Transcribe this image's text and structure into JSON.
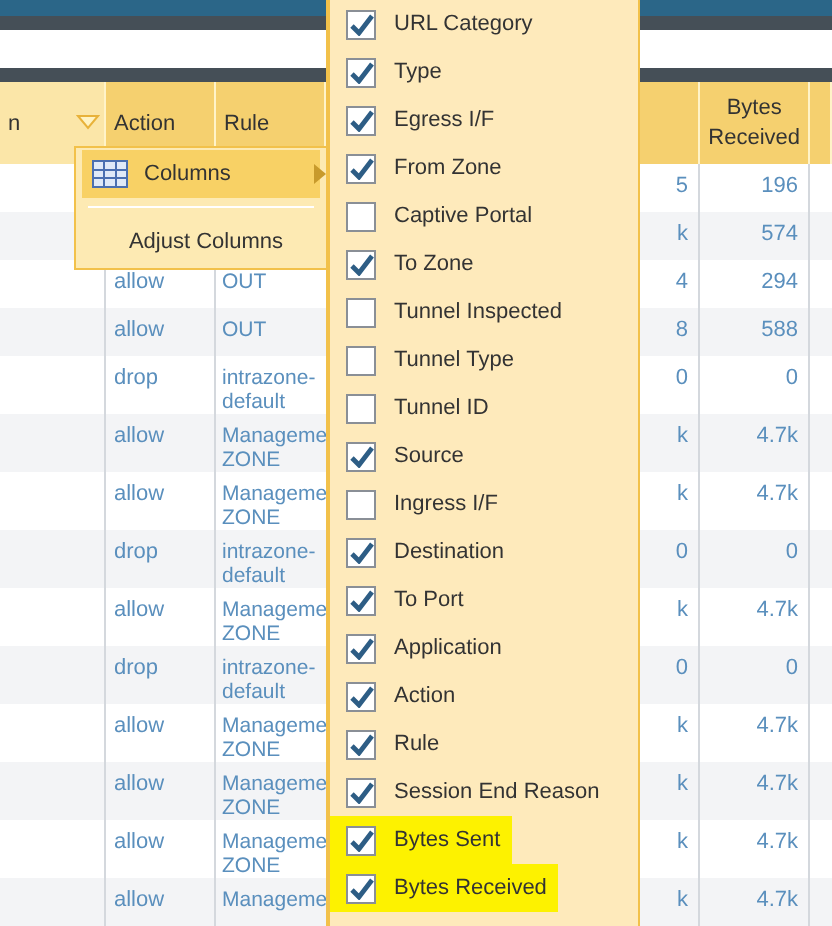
{
  "table": {
    "columns": [
      {
        "label": "n",
        "menu_open": true
      },
      {
        "label": "Action"
      },
      {
        "label": "Rule"
      },
      {
        "label": "Bytes Received"
      }
    ],
    "rows": [
      {
        "column_4": "5",
        "bytes_received": "196"
      },
      {
        "column_4": "k",
        "bytes_received": "574"
      },
      {
        "action": "allow",
        "rule": "OUT",
        "column_4": "4",
        "bytes_received": "294"
      },
      {
        "action": "allow",
        "rule": "OUT",
        "column_4": "8",
        "bytes_received": "588"
      },
      {
        "action": "drop",
        "rule": "intrazone-default",
        "column_4": "0",
        "bytes_received": "0"
      },
      {
        "action": "allow",
        "rule": "Manageme ZONE",
        "column_4": "k",
        "bytes_received": "4.7k"
      },
      {
        "action": "allow",
        "rule": "Manageme ZONE",
        "column_4": "k",
        "bytes_received": "4.7k"
      },
      {
        "action": "drop",
        "rule": "intrazone-default",
        "column_4": "0",
        "bytes_received": "0"
      },
      {
        "action": "allow",
        "rule": "Manageme ZONE",
        "column_4": "k",
        "bytes_received": "4.7k"
      },
      {
        "action": "drop",
        "rule": "intrazone-default",
        "column_4": "0",
        "bytes_received": "0"
      },
      {
        "action": "allow",
        "rule": "Manageme ZONE",
        "column_4": "k",
        "bytes_received": "4.7k"
      },
      {
        "action": "allow",
        "rule": "Manageme ZONE",
        "column_4": "k",
        "bytes_received": "4.7k"
      },
      {
        "action": "allow",
        "rule": "Manageme ZONE",
        "column_4": "k",
        "bytes_received": "4.7k"
      },
      {
        "action": "allow",
        "rule": "Manageme",
        "column_4": "k",
        "bytes_received": "4.7k"
      }
    ]
  },
  "column_menu": {
    "items": [
      {
        "label": "Columns",
        "selected": true,
        "submenu": true
      },
      {
        "label": "Adjust Columns",
        "selected": false,
        "submenu": false
      }
    ]
  },
  "columns_submenu": {
    "items": [
      {
        "label": "URL Category",
        "checked": true,
        "highlighted": false
      },
      {
        "label": "Type",
        "checked": true,
        "highlighted": false
      },
      {
        "label": "Egress I/F",
        "checked": true,
        "highlighted": false
      },
      {
        "label": "From Zone",
        "checked": true,
        "highlighted": false
      },
      {
        "label": "Captive Portal",
        "checked": false,
        "highlighted": false
      },
      {
        "label": "To Zone",
        "checked": true,
        "highlighted": false
      },
      {
        "label": "Tunnel Inspected",
        "checked": false,
        "highlighted": false
      },
      {
        "label": "Tunnel Type",
        "checked": false,
        "highlighted": false
      },
      {
        "label": "Tunnel ID",
        "checked": false,
        "highlighted": false
      },
      {
        "label": "Source",
        "checked": true,
        "highlighted": false
      },
      {
        "label": "Ingress I/F",
        "checked": false,
        "highlighted": false
      },
      {
        "label": "Destination",
        "checked": true,
        "highlighted": false
      },
      {
        "label": "To Port",
        "checked": true,
        "highlighted": false
      },
      {
        "label": "Application",
        "checked": true,
        "highlighted": false
      },
      {
        "label": "Action",
        "checked": true,
        "highlighted": false
      },
      {
        "label": "Rule",
        "checked": true,
        "highlighted": false
      },
      {
        "label": "Session End Reason",
        "checked": true,
        "highlighted": false
      },
      {
        "label": "Bytes Sent",
        "checked": true,
        "highlighted": true
      },
      {
        "label": "Bytes Received",
        "checked": true,
        "highlighted": true
      }
    ]
  }
}
